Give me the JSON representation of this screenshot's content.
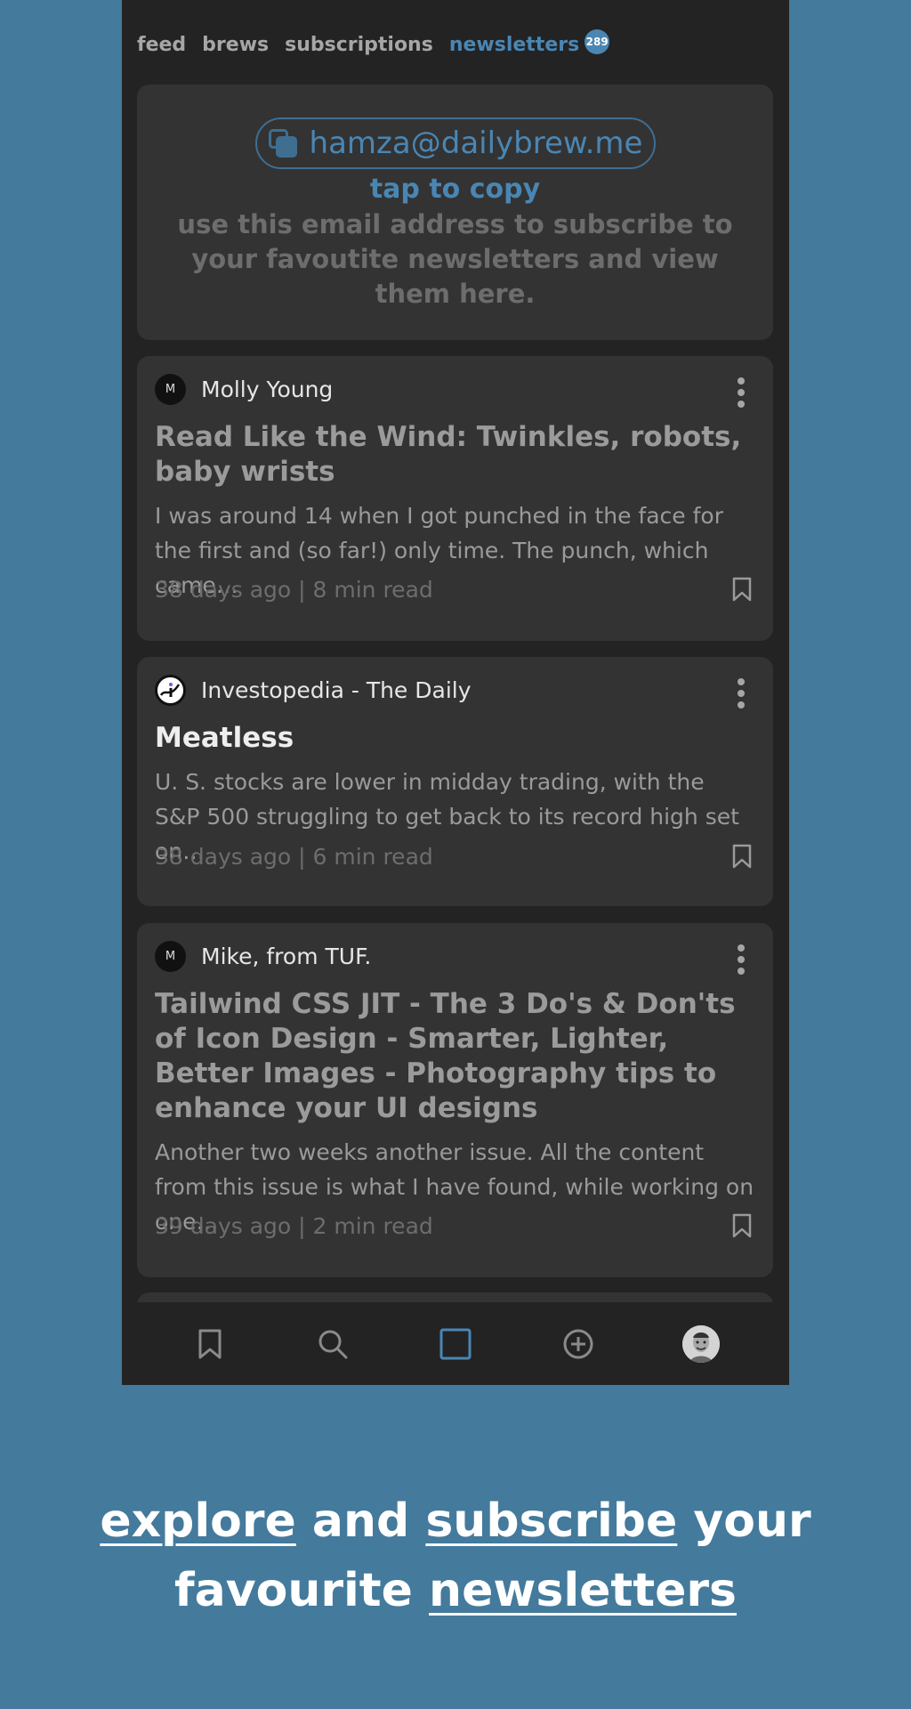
{
  "tabs": [
    {
      "label": "feed"
    },
    {
      "label": "brews"
    },
    {
      "label": "subscriptions"
    },
    {
      "label": "newsletters"
    }
  ],
  "newsletter_badge": "289",
  "email_card": {
    "email": "hamza@dailybrew.me",
    "tap_to_copy": "tap to copy",
    "description": "use this email address to subscribe to your favoutite newsletters and view them here."
  },
  "posts": [
    {
      "author": "Molly Young",
      "avatar_letter": "M",
      "title": "Read Like the Wind: Twinkles, robots, baby wrists",
      "excerpt": "I was around 14 when I got punched in the face for the first and (so far!) only time. The punch, which came…",
      "meta": "38 days ago | 8 min read"
    },
    {
      "author": "Investopedia - The Daily",
      "title": "Meatless",
      "excerpt": "U. S. stocks are lower in midday trading, with the S&P 500 struggling to get back to its record high set on…",
      "meta": "38 days ago | 6 min read"
    },
    {
      "author": "Mike, from TUF.",
      "avatar_letter": "M",
      "title": "Tailwind CSS JIT - The 3 Do's & Don'ts of Icon Design - Smarter, Lighter, Better Images  - Photography tips to enhance your UI designs",
      "excerpt": "Another two weeks another issue. All the content from this issue is what I have found, while working on one…",
      "meta": "39 days ago | 2 min read"
    }
  ],
  "tagline": {
    "explore": "explore",
    "and": " and ",
    "subscribe": "subscribe",
    "your": " your",
    "favourite": "favourite ",
    "newsletters": "newsletters"
  },
  "colors": {
    "background": "#447a9c",
    "app_background": "#232323",
    "card": "#333333",
    "accent": "#4a86b3"
  },
  "icons": {
    "bottom_nav": [
      "bookmark-icon",
      "search-icon",
      "square-icon",
      "plus-circle-icon",
      "profile-avatar"
    ]
  }
}
